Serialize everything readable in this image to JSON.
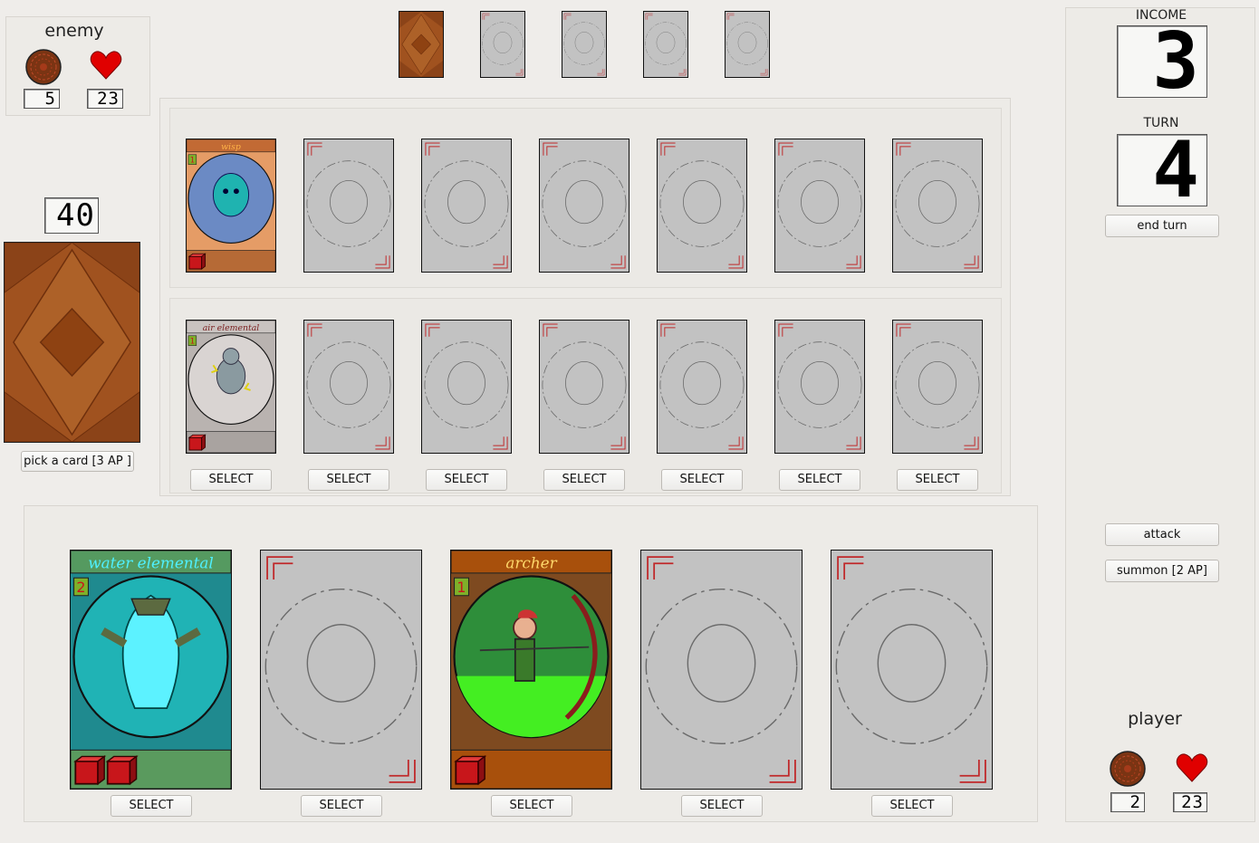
{
  "enemy": {
    "title": "enemy",
    "resource_value": "5",
    "health_value": "23",
    "coin_icon": "resource-token-icon",
    "heart_icon": "heart-icon"
  },
  "player": {
    "title": "player",
    "resource_value": "2",
    "health_value": "23"
  },
  "deck": {
    "count": "40",
    "pick_label": "pick a card [3 AP ]"
  },
  "side_panel": {
    "income_label": "INCOME",
    "income_value": "3",
    "turn_label": "TURN",
    "turn_value": "4",
    "end_turn_label": "end turn",
    "attack_label": "attack",
    "summon_label": "summon [2 AP]"
  },
  "enemy_hand": [
    "card-back",
    "empty",
    "empty",
    "empty",
    "empty"
  ],
  "board": {
    "enemy_row": [
      {
        "name": "wisp",
        "cost": "1",
        "dice": 1,
        "type": "wisp"
      },
      null,
      null,
      null,
      null,
      null,
      null
    ],
    "player_row": [
      {
        "name": "air elemental",
        "cost": "1",
        "dice": 1,
        "type": "air"
      },
      null,
      null,
      null,
      null,
      null,
      null
    ],
    "select_label": "SELECT"
  },
  "hand": [
    {
      "name": "water elemental",
      "cost": "2",
      "dice": 2,
      "type": "water"
    },
    null,
    {
      "name": "archer",
      "cost": "1",
      "dice": 1,
      "type": "archer"
    },
    null,
    null
  ],
  "colors": {
    "background": "#efedea",
    "card_back_brown": "#a0521f",
    "empty_slot": "#c2c2c2",
    "slot_corner_red": "#c0282a",
    "heart_red": "#e00000"
  }
}
